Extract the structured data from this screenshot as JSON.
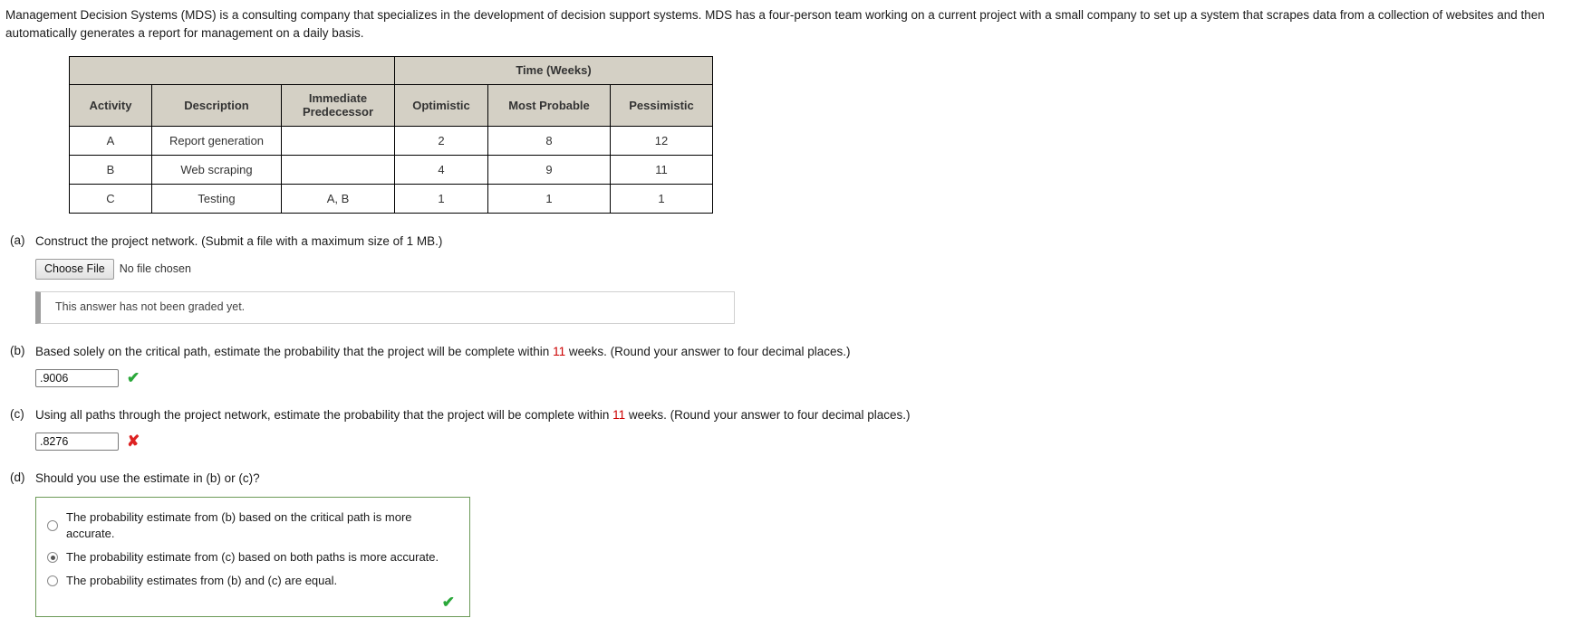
{
  "intro": {
    "paragraph": "Management Decision Systems (MDS) is a consulting company that specializes in the development of decision support systems. MDS has a four-person team working on a current project with a small company to set up a system that scrapes data from a collection of websites and then automatically generates a report for management on a daily basis."
  },
  "table": {
    "group_header": "Time (Weeks)",
    "headers": [
      "Activity",
      "Description",
      "Immediate Predecessor",
      "Optimistic",
      "Most Probable",
      "Pessimistic"
    ],
    "header_activity": "Activity",
    "header_description": "Description",
    "header_predecessor_line1": "Immediate",
    "header_predecessor_line2": "Predecessor",
    "header_optimistic": "Optimistic",
    "header_most_probable": "Most Probable",
    "header_pessimistic": "Pessimistic",
    "rows": [
      {
        "activity": "A",
        "description": "Report generation",
        "predecessor": "",
        "optimistic": "2",
        "most_probable": "8",
        "pessimistic": "12",
        "highlight": true
      },
      {
        "activity": "B",
        "description": "Web scraping",
        "predecessor": "",
        "optimistic": "4",
        "most_probable": "9",
        "pessimistic": "11",
        "highlight": true
      },
      {
        "activity": "C",
        "description": "Testing",
        "predecessor": "A, B",
        "optimistic": "1",
        "most_probable": "1",
        "pessimistic": "1",
        "highlight": false
      }
    ]
  },
  "questions": {
    "a": {
      "label": "(a)",
      "text": "Construct the project network. (Submit a file with a maximum size of 1 MB.)",
      "choose_file_label": "Choose File",
      "no_file_text": "No file chosen",
      "ungraded_text": "This answer has not been graded yet."
    },
    "b": {
      "label": "(b)",
      "text_part1": "Based solely on the critical path, estimate the probability that the project will be complete within ",
      "weeks_value": "11",
      "text_part2": " weeks. (Round your answer to four decimal places.)",
      "answer_value": ".9006",
      "mark": "✔",
      "mark_state": "correct"
    },
    "c": {
      "label": "(c)",
      "text_part1": "Using all paths through the project network, estimate the probability that the project will be complete within ",
      "weeks_value": "11",
      "text_part2": " weeks. (Round your answer to four decimal places.)",
      "answer_value": ".8276",
      "mark": "✘",
      "mark_state": "wrong"
    },
    "d": {
      "label": "(d)",
      "text": "Should you use the estimate in (b) or (c)?",
      "options": [
        {
          "label": "The probability estimate from (b) based on the critical path is more accurate.",
          "selected": false
        },
        {
          "label": "The probability estimate from (c) based on both paths is more accurate.",
          "selected": true
        },
        {
          "label": "The probability estimates from (b) and (c) are equal.",
          "selected": false
        }
      ],
      "mark": "✔",
      "mark_state": "correct"
    }
  },
  "colors": {
    "header_bg": "#d4d0c5",
    "value_red": "#cc0000",
    "correct_green": "#2aa83a",
    "wrong_red": "#dd2222",
    "radio_box_border": "#6c9a58"
  }
}
